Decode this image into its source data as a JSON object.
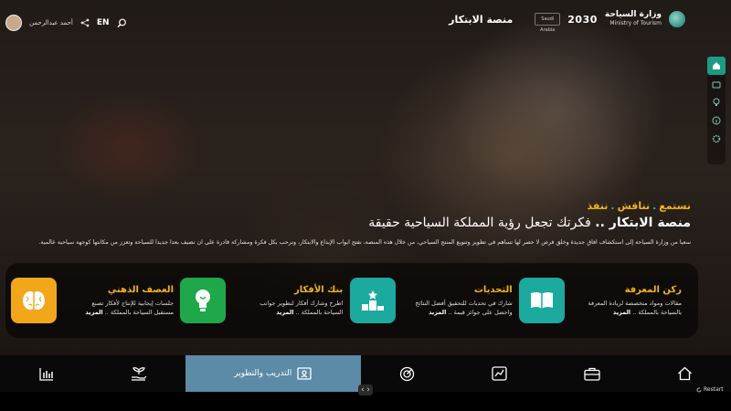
{
  "header": {
    "language": "EN",
    "user_name": "أحمد عبدالرحمن",
    "platform_name": "منصة الابتكار",
    "vision_logo": "2030",
    "ministry_ar": "وزارة السياحة",
    "ministry_en": "Ministry of Tourism",
    "small_logo_text": "Saudi Arabia"
  },
  "hero": {
    "tag_listen": "نستمع",
    "tag_discuss": "نناقش",
    "tag_execute": "ننفذ",
    "title_bold": "منصة الابتكار ..",
    "title_rest": " فكرتك تجعل رؤية المملكة السياحية حقيقة",
    "description": "سعياً من وزارة السياحة إلى استكشاف آفاق جديدة وخلق فرص لا حصر لها تساهم في تطوير وتنويع المنتج السياحي، من خلال هذه المنصة، نفتح أبواب الإبداع والابتكار، ونرحب بكل فكرة ومشاركة قادرة على أن تضيف بعداً جديداً للسياحة وتعزز من مكانتها كوجهة سياحية عالمية."
  },
  "cards": [
    {
      "title": "ركن المعرفة",
      "desc1": "مقالات ومواد متخصصة لزيادة المعرفة",
      "desc2": "بالسياحة بالمملكة .. ",
      "more": "المزيد",
      "color": "#1ca99e",
      "icon": "book-icon"
    },
    {
      "title": "التحديات",
      "desc1": "شارك في تحديات للتحقيق أفضل النتائج",
      "desc2": "واحصل على جوائز قيمة .. ",
      "more": "المزيد",
      "color": "#1ca99e",
      "icon": "podium-icon"
    },
    {
      "title": "بنك الأفكار",
      "desc1": "اطرح وشارك أفكار لتطوير جوانب",
      "desc2": "السياحة بالمملكة .. ",
      "more": "المزيد",
      "color": "#1ea84a",
      "icon": "lightbulb-icon"
    },
    {
      "title": "العصف الذهني",
      "desc1": "جلسات إيجابية للإنتاج لأفكار تصنع",
      "desc2": "مستقبل السياحة بالمملكة .. ",
      "more": "المزيد",
      "color": "#f2a71b",
      "icon": "brain-icon"
    }
  ],
  "nav": {
    "active_label": "التدريب والتطوير"
  },
  "restart_label": "Restart"
}
